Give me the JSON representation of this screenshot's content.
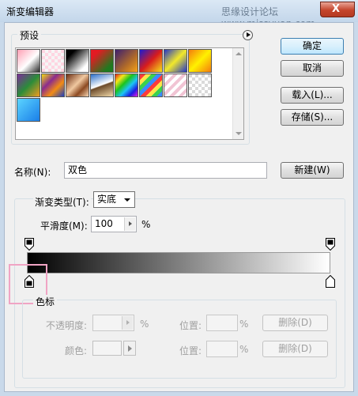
{
  "window": {
    "title": "渐变编辑器",
    "watermark": "思缘设计论坛 www.missyuan.com",
    "close_glyph": "X"
  },
  "presets": {
    "legend": "预设",
    "swatches": [
      {
        "name": "foreground-to-background",
        "css": "linear-gradient(135deg,#ff9fb4,#ffffff 55%,#2b2b2b)"
      },
      {
        "name": "foreground-to-transparent",
        "css": "repeating-conic-gradient(#f5f5f5 0 25%, #ffd6e2 0 50%) 0 0/8px 8px"
      },
      {
        "name": "black-white",
        "css": "linear-gradient(135deg,#000 20%,#fff 80%)"
      },
      {
        "name": "red-green",
        "css": "linear-gradient(135deg,#e31b23 20%,#1f7a1f 80%)"
      },
      {
        "name": "violet-orange",
        "css": "linear-gradient(135deg,#3c1f6e,#b06a2a 60%,#f6a318)"
      },
      {
        "name": "blue-red-yellow",
        "css": "linear-gradient(135deg,#1b1bd0,#d81c1c 50%,#f5e51a)"
      },
      {
        "name": "blue-yellow-blue",
        "css": "linear-gradient(135deg,#2336c8,#f2e92a 50%,#2336c8)"
      },
      {
        "name": "orange-yellow-orange",
        "css": "linear-gradient(135deg,#f47c0e,#fff100 50%,#f47c0e)"
      },
      {
        "name": "violet-green-orange",
        "css": "linear-gradient(135deg,#7b2d9a,#2b8c3a 50%,#f29a1f)"
      },
      {
        "name": "yellow-violet-orange-blue",
        "css": "linear-gradient(135deg,#f5dd12,#8b2b8e 35%,#f28c14 65%,#1d3ec0)"
      },
      {
        "name": "copper",
        "css": "linear-gradient(135deg,#6b2d12,#f0c8a0 45%,#8c4a22 70%,#f7d7b4)"
      },
      {
        "name": "chrome",
        "css": "linear-gradient(160deg,#2a6ec8,#ffffff 48%,#6b4a2a 52%,#f0d8a8)"
      },
      {
        "name": "spectrum",
        "css": "linear-gradient(135deg,#e41c1c,#f5e51a,#1cc41c,#1cc4f5,#1c1ce4,#e41ce4)"
      },
      {
        "name": "transparent-rainbow",
        "css": "repeating-linear-gradient(135deg,#ff3b3b 0 5px,#ffe54a 5px 10px,#3bd14f 10px 15px,#3b8cff 15px 20px)"
      },
      {
        "name": "transparent-stripes",
        "css": "repeating-linear-gradient(135deg,#f1c4d4 0 4px,#ffffff 4px 8px)"
      },
      {
        "name": "neutral-density",
        "css": "repeating-conic-gradient(#ffffff 0 25%, #dadada 0 50%) 0 0/8px 8px"
      },
      {
        "name": "cyan-blue",
        "css": "linear-gradient(135deg,#5bd4ff,#1a7ee8)"
      }
    ]
  },
  "buttons": {
    "ok": "确定",
    "cancel": "取消",
    "load": "载入(L)...",
    "save": "存储(S)...",
    "new": "新建(W)"
  },
  "name_field": {
    "label": "名称(N):",
    "value": "双色"
  },
  "gradient_type": {
    "label": "渐变类型(T):",
    "value": "实底"
  },
  "smoothness": {
    "label": "平滑度(M):",
    "value": "100",
    "unit": "%"
  },
  "gradient": {
    "start_color": "#000000",
    "end_color": "#ffffff"
  },
  "stops_section": {
    "legend": "色标",
    "opacity_label": "不透明度:",
    "opacity_unit": "%",
    "location_label": "位置:",
    "location_unit": "%",
    "delete_label": "删除(D)",
    "color_label": "颜色:",
    "location2_label": "位置:",
    "location2_unit": "%",
    "delete2_label": "删除(D)"
  }
}
